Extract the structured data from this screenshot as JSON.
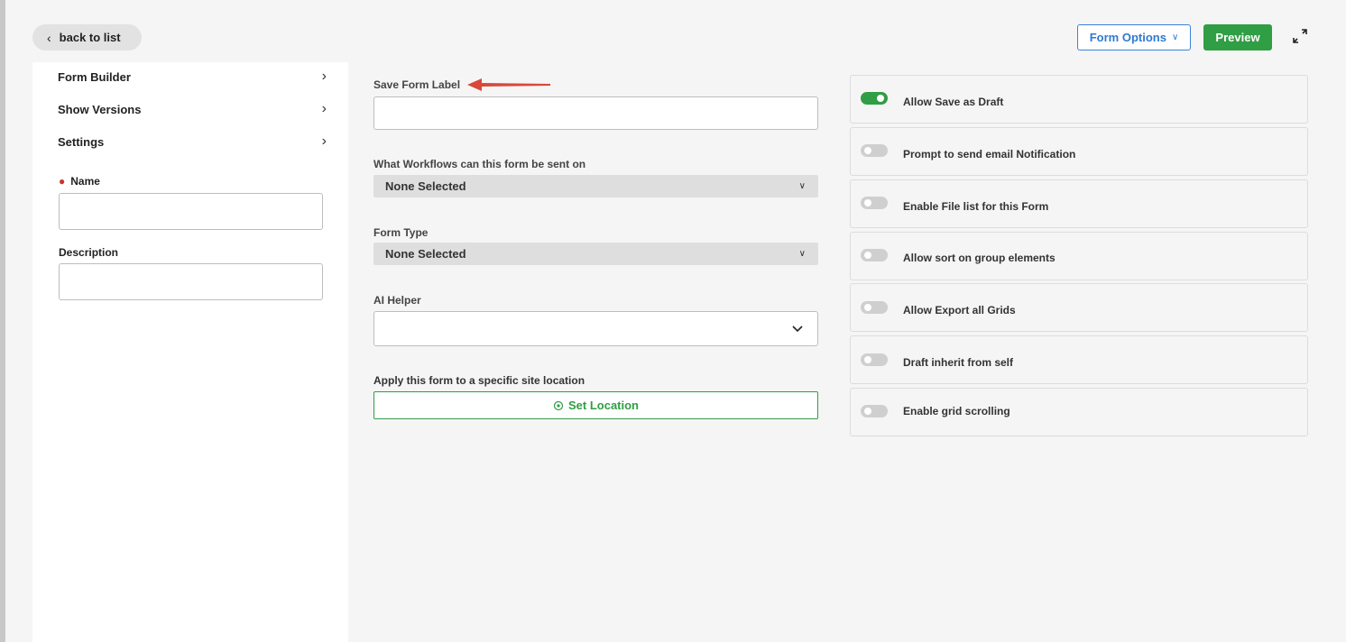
{
  "header": {
    "back_label": "back to list",
    "form_options_label": "Form Options",
    "preview_label": "Preview"
  },
  "sidebar": {
    "items": [
      {
        "label": "Form Builder"
      },
      {
        "label": "Show Versions"
      },
      {
        "label": "Settings"
      }
    ],
    "name_label": "Name",
    "name_value": "",
    "description_label": "Description",
    "description_value": ""
  },
  "settings": {
    "save_form_label": "Save Form Label",
    "save_form_value": "",
    "workflows_label": "What Workflows can this form be sent on",
    "workflows_value": "None Selected",
    "form_type_label": "Form Type",
    "form_type_value": "None Selected",
    "ai_helper_label": "AI Helper",
    "ai_helper_value": "",
    "site_location_label": "Apply this form to a specific site location",
    "set_location_label": "Set Location"
  },
  "options": [
    {
      "label": "Allow Save as Draft",
      "enabled": true
    },
    {
      "label": "Prompt to send email Notification",
      "enabled": false
    },
    {
      "label": "Enable File list for this Form",
      "enabled": false
    },
    {
      "label": "Allow sort on group elements",
      "enabled": false
    },
    {
      "label": "Allow Export all Grids",
      "enabled": false
    },
    {
      "label": "Draft inherit from self",
      "enabled": false
    },
    {
      "label": "Enable grid scrolling",
      "enabled": false
    }
  ],
  "colors": {
    "accent_green": "#2f9e44",
    "accent_blue": "#2e7ad1",
    "required_red": "#d0312d",
    "annotation_red": "#d9483b"
  }
}
